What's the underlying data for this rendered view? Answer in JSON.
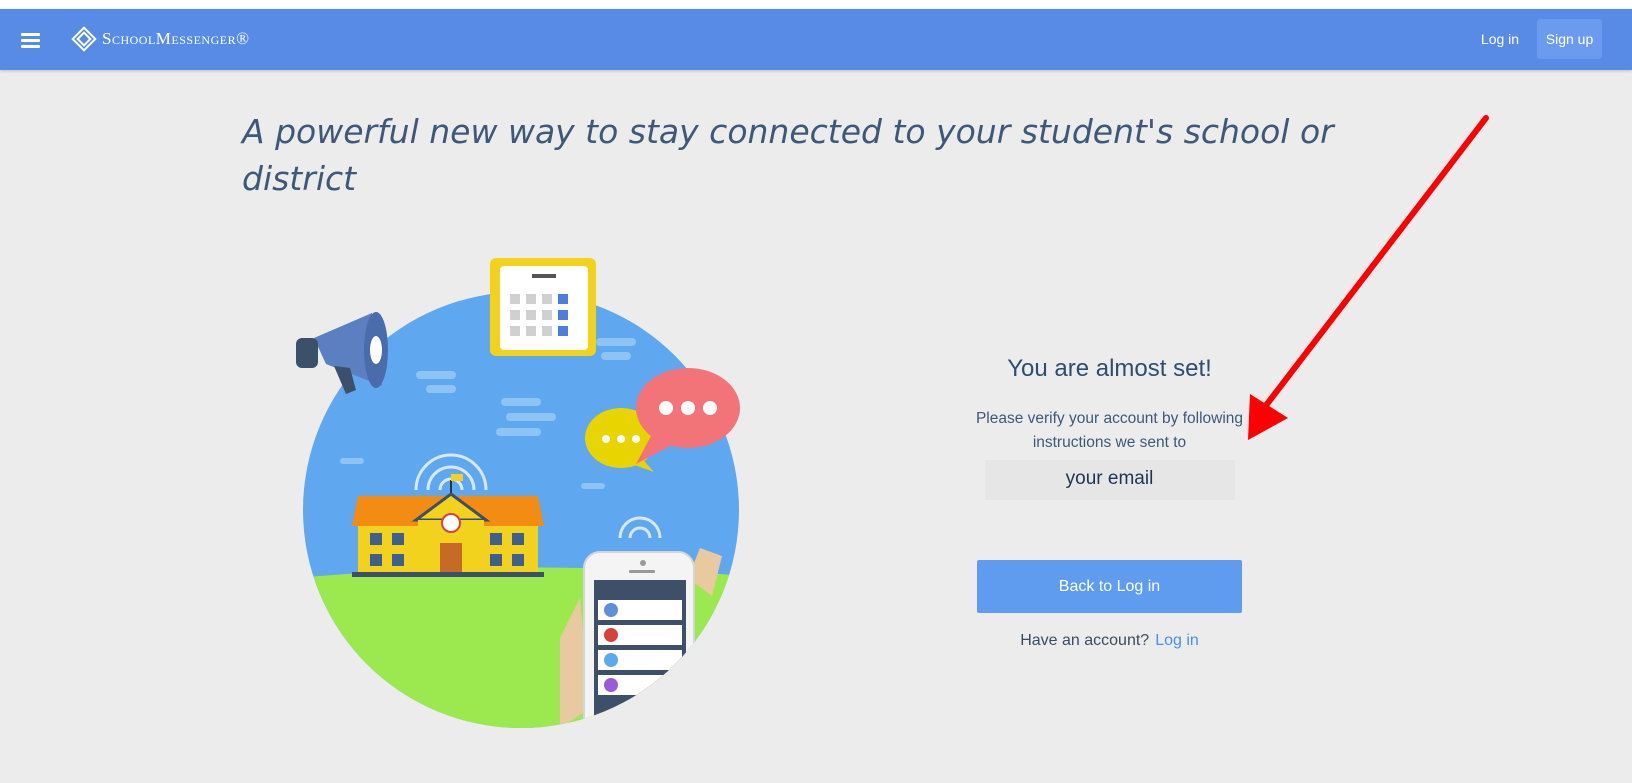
{
  "header": {
    "brand": "SchoolMessenger®",
    "login_label": "Log in",
    "signup_label": "Sign up"
  },
  "main": {
    "headline": "A powerful new way to stay connected to your student's school or district"
  },
  "card": {
    "title": "You are almost set!",
    "message": "Please verify your account by following instructions we sent to",
    "email": "your email",
    "back_button": "Back to Log in",
    "have_account": "Have an account?",
    "login_link": "Log in"
  },
  "colors": {
    "navbar": "#578be6",
    "button": "#5f9cef",
    "link": "#4c8df0",
    "background": "#ececec",
    "annotation_arrow": "#ff0000"
  }
}
